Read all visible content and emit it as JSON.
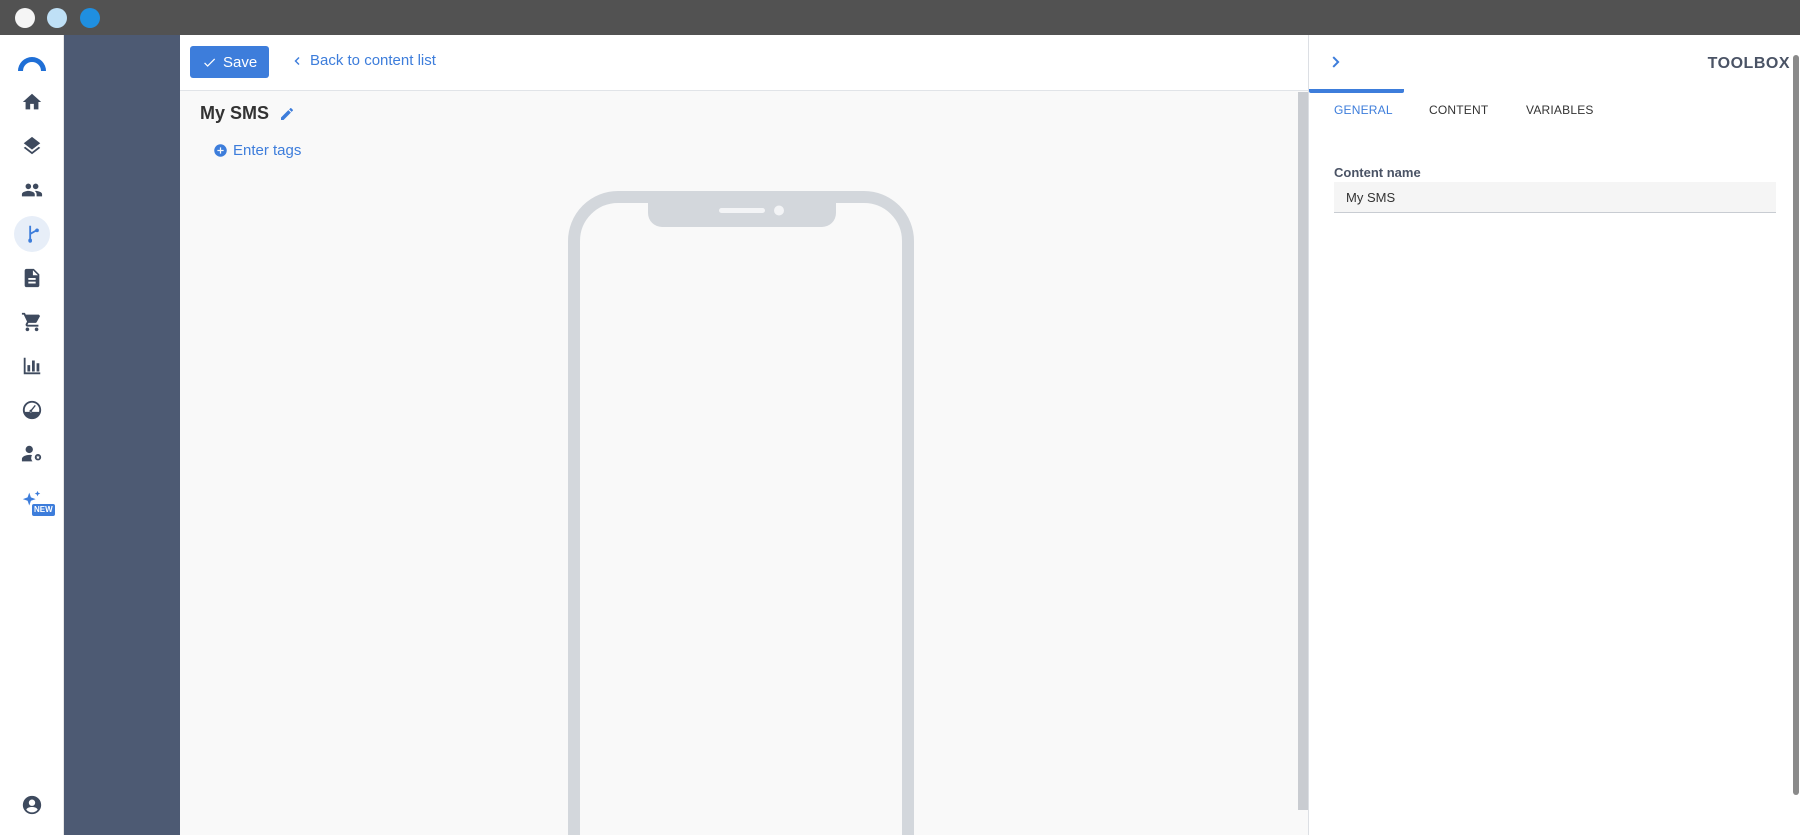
{
  "window": {
    "controls": [
      "close",
      "minimize",
      "maximize"
    ]
  },
  "rail": {
    "items": [
      {
        "name": "home-icon"
      },
      {
        "name": "layers-icon"
      },
      {
        "name": "users-icon"
      },
      {
        "name": "journey-icon",
        "active": true
      },
      {
        "name": "document-icon"
      },
      {
        "name": "cart-icon"
      },
      {
        "name": "chart-icon"
      },
      {
        "name": "speedometer-icon"
      },
      {
        "name": "user-settings-icon"
      },
      {
        "name": "sparkle-icon",
        "badge": "NEW"
      }
    ],
    "bottom_item": {
      "name": "account-icon"
    }
  },
  "toolbar": {
    "save_label": "Save",
    "back_label": "Back to content list"
  },
  "document": {
    "title": "My SMS",
    "tags_label": "Enter tags"
  },
  "toolbox": {
    "title": "TOOLBOX",
    "tabs": [
      {
        "label": "GENERAL",
        "active": true
      },
      {
        "label": "CONTENT"
      },
      {
        "label": "VARIABLES"
      }
    ],
    "content_name_label": "Content name",
    "content_name_value": "My SMS"
  },
  "colors": {
    "accent": "#3d7ddb",
    "dark_panel": "#4d5a73",
    "titlebar": "#525252"
  }
}
